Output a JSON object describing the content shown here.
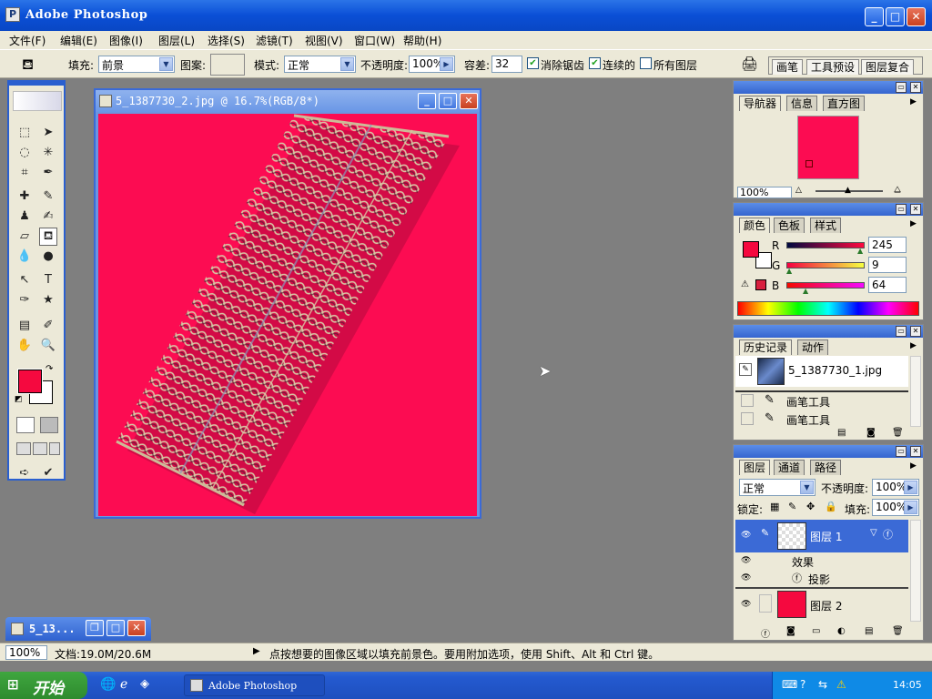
{
  "app": {
    "title": "Adobe Photoshop",
    "icon": "ps-icon"
  },
  "window_controls": {
    "minimize": "_",
    "maximize": "□",
    "close": "✕"
  },
  "menu": [
    "文件(F)",
    "编辑(E)",
    "图像(I)",
    "图层(L)",
    "选择(S)",
    "滤镜(T)",
    "视图(V)",
    "窗口(W)",
    "帮助(H)"
  ],
  "options": {
    "fill_label": "填充:",
    "fill_value": "前景",
    "pattern_label": "图案:",
    "mode_label": "模式:",
    "mode_value": "正常",
    "opacity_label": "不透明度:",
    "opacity_value": "100%",
    "tolerance_label": "容差:",
    "tolerance_value": "32",
    "antialias_label": "消除锯齿",
    "antialias_checked": true,
    "contiguous_label": "连续的",
    "contiguous_checked": true,
    "all_layers_label": "所有图层",
    "all_layers_checked": false,
    "palette_tabs": [
      "画笔",
      "工具预设",
      "图层复合"
    ]
  },
  "document": {
    "title": "5_1387730_2.jpg @ 16.7%(RGB/8*)",
    "canvas_color": "#fc0c52"
  },
  "foreground_color": "#f5093f",
  "background_color": "#ffffff",
  "navigator": {
    "tabs": [
      "导航器",
      "信息",
      "直方图"
    ],
    "zoom": "100%"
  },
  "color_panel": {
    "tabs": [
      "颜色",
      "色板",
      "样式"
    ],
    "r_label": "R",
    "r": "245",
    "g_label": "G",
    "g": "9",
    "b_label": "B",
    "b": "64"
  },
  "history": {
    "tabs": [
      "历史记录",
      "动作"
    ],
    "snapshot": "5_1387730_1.jpg",
    "items": [
      "画笔工具",
      "画笔工具"
    ]
  },
  "layers": {
    "tabs": [
      "图层",
      "通道",
      "路径"
    ],
    "blend_mode": "正常",
    "opacity_label": "不透明度:",
    "opacity": "100%",
    "lock_label": "锁定:",
    "fill_label": "填充:",
    "fill": "100%",
    "layer1": "图层 1",
    "effects_label": "效果",
    "drop_shadow": "投影",
    "layer2": "图层 2"
  },
  "minimized_doc": {
    "title": "5_13..."
  },
  "status": {
    "zoom": "100%",
    "doc_size": "文档:19.0M/20.6M",
    "hint": "点按想要的图像区域以填充前景色。要用附加选项，使用 Shift、Alt 和 Ctrl 键。"
  },
  "taskbar": {
    "start": "开始",
    "task": "Adobe Photoshop",
    "clock": "14:05"
  }
}
